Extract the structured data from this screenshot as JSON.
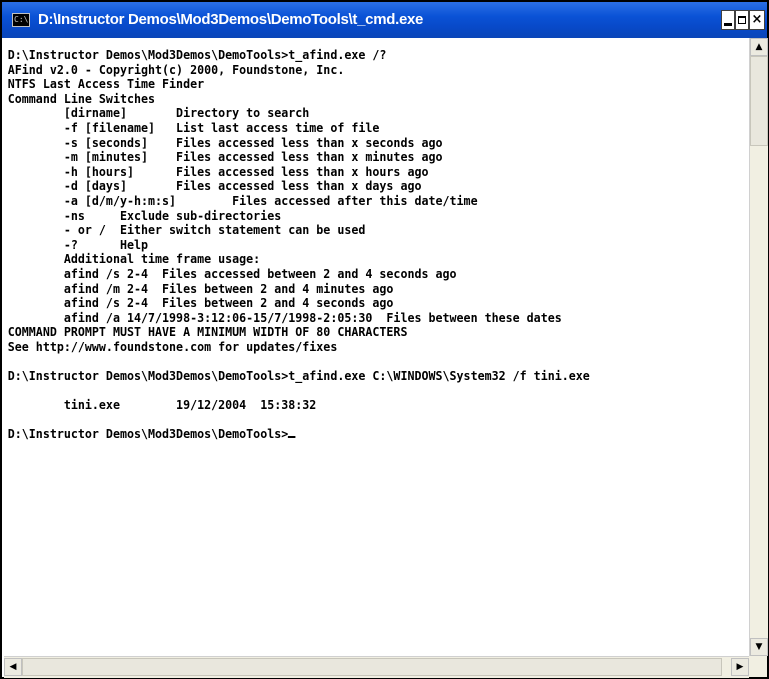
{
  "window": {
    "title": "D:\\Instructor Demos\\Mod3Demos\\DemoTools\\t_cmd.exe",
    "icon": "cmd-icon",
    "buttons": {
      "minimize": "minimize-icon",
      "maximize": "maximize-icon",
      "close": "×"
    }
  },
  "console": {
    "lines": [
      "D:\\Instructor Demos\\Mod3Demos\\DemoTools>t_afind.exe /?",
      "AFind v2.0 - Copyright(c) 2000, Foundstone, Inc.",
      "NTFS Last Access Time Finder",
      "Command Line Switches",
      "        [dirname]       Directory to search",
      "        -f [filename]   List last access time of file",
      "        -s [seconds]    Files accessed less than x seconds ago",
      "        -m [minutes]    Files accessed less than x minutes ago",
      "        -h [hours]      Files accessed less than x hours ago",
      "        -d [days]       Files accessed less than x days ago",
      "        -a [d/m/y-h:m:s]        Files accessed after this date/time",
      "        -ns     Exclude sub-directories",
      "        - or /  Either switch statement can be used",
      "        -?      Help",
      "        Additional time frame usage:",
      "        afind /s 2-4  Files accessed between 2 and 4 seconds ago",
      "        afind /m 2-4  Files between 2 and 4 minutes ago",
      "        afind /s 2-4  Files between 2 and 4 seconds ago",
      "        afind /a 14/7/1998-3:12:06-15/7/1998-2:05:30  Files between these dates",
      "COMMAND PROMPT MUST HAVE A MINIMUM WIDTH OF 80 CHARACTERS",
      "See http://www.foundstone.com for updates/fixes",
      "",
      "D:\\Instructor Demos\\Mod3Demos\\DemoTools>t_afind.exe C:\\WINDOWS\\System32 /f tini.exe",
      "",
      "        tini.exe        19/12/2004  15:38:32",
      ""
    ],
    "prompt": "D:\\Instructor Demos\\Mod3Demos\\DemoTools>"
  },
  "scrollbars": {
    "up": "▲",
    "down": "▼",
    "left": "◀",
    "right": "▶"
  }
}
